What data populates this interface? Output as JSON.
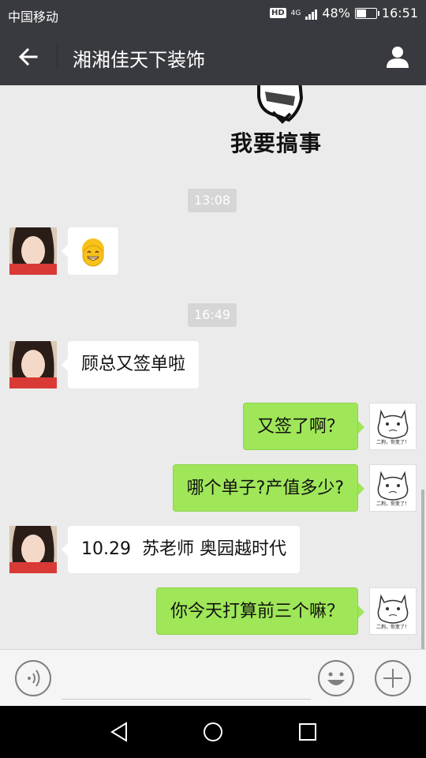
{
  "status_bar": {
    "carrier": "中国移动",
    "hd": "HD",
    "network": "4G",
    "battery_percent": "48%",
    "battery_level": 0.48,
    "time": "16:51"
  },
  "header": {
    "title": "湘湘佳天下装饰",
    "back_icon": "arrow-left-icon",
    "profile_icon": "person-icon"
  },
  "chat": {
    "sticker_text": "我要搞事",
    "timestamps": [
      "13:08",
      "16:49"
    ],
    "messages": [
      {
        "side": "left",
        "type": "emoji",
        "content": "grinning-emoji"
      },
      {
        "side": "left",
        "type": "text",
        "content": "顾总又签单啦"
      },
      {
        "side": "right",
        "type": "text",
        "content": "又签了啊？"
      },
      {
        "side": "right",
        "type": "text",
        "content": "哪个单子?产值多少?"
      },
      {
        "side": "left",
        "type": "text",
        "content": "10.29  苏老师 奥园越时代"
      },
      {
        "side": "right",
        "type": "text",
        "content": "你今天打算前三个嘛？"
      }
    ],
    "avatar_caption": "二狗，你变了！"
  },
  "input_bar": {
    "placeholder": "",
    "voice_icon": "voice-icon",
    "emoji_icon": "smiley-icon",
    "plus_icon": "plus-icon"
  },
  "colors": {
    "title_bar": "#393a3f",
    "chat_bg": "#ebebeb",
    "bubble_sent": "#9fe658",
    "bubble_received": "#ffffff"
  }
}
